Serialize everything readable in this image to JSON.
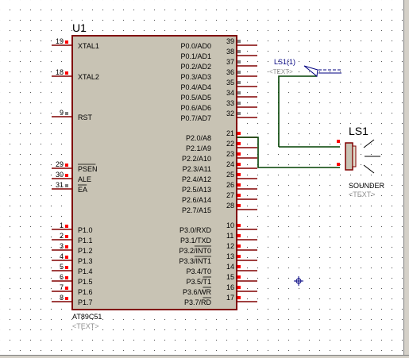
{
  "mcu": {
    "ref": "U1",
    "part": "AT89C51",
    "text_placeholder": "<TEXT>",
    "left_pins": [
      {
        "num": "19",
        "name": "XTAL1",
        "over": false
      },
      {
        "num": "18",
        "name": "XTAL2",
        "over": false
      },
      {
        "num": "9",
        "name": "RST",
        "over": false
      },
      {
        "num": "29",
        "name": "PSEN",
        "over": true
      },
      {
        "num": "30",
        "name": "ALE",
        "over": false
      },
      {
        "num": "31",
        "name": "EA",
        "over": true
      },
      {
        "num": "1",
        "name": "P1.0",
        "over": false
      },
      {
        "num": "2",
        "name": "P1.1",
        "over": false
      },
      {
        "num": "3",
        "name": "P1.2",
        "over": false
      },
      {
        "num": "4",
        "name": "P1.3",
        "over": false
      },
      {
        "num": "5",
        "name": "P1.4",
        "over": false
      },
      {
        "num": "6",
        "name": "P1.5",
        "over": false
      },
      {
        "num": "7",
        "name": "P1.6",
        "over": false
      },
      {
        "num": "8",
        "name": "P1.7",
        "over": false
      }
    ],
    "right_pins": [
      {
        "num": "39",
        "name": "P0.0/AD0",
        "over": ""
      },
      {
        "num": "38",
        "name": "P0.1/AD1",
        "over": ""
      },
      {
        "num": "37",
        "name": "P0.2/AD2",
        "over": ""
      },
      {
        "num": "36",
        "name": "P0.3/AD3",
        "over": ""
      },
      {
        "num": "35",
        "name": "P0.4/AD4",
        "over": ""
      },
      {
        "num": "34",
        "name": "P0.5/AD5",
        "over": ""
      },
      {
        "num": "33",
        "name": "P0.6/AD6",
        "over": ""
      },
      {
        "num": "32",
        "name": "P0.7/AD7",
        "over": ""
      },
      {
        "num": "21",
        "name": "P2.0/A8",
        "over": ""
      },
      {
        "num": "22",
        "name": "P2.1/A9",
        "over": ""
      },
      {
        "num": "23",
        "name": "P2.2/A10",
        "over": ""
      },
      {
        "num": "24",
        "name": "P2.3/A11",
        "over": ""
      },
      {
        "num": "25",
        "name": "P2.4/A12",
        "over": ""
      },
      {
        "num": "26",
        "name": "P2.5/A13",
        "over": ""
      },
      {
        "num": "27",
        "name": "P2.6/A14",
        "over": ""
      },
      {
        "num": "28",
        "name": "P2.7/A15",
        "over": ""
      },
      {
        "num": "10",
        "name": "P3.0/RXD",
        "over": ""
      },
      {
        "num": "11",
        "name": "P3.1/TXD",
        "over": ""
      },
      {
        "num": "12",
        "name": "P3.2/INT0",
        "over": "INT0"
      },
      {
        "num": "13",
        "name": "P3.3/INT1",
        "over": "INT1"
      },
      {
        "num": "14",
        "name": "P3.4/T0",
        "over": ""
      },
      {
        "num": "15",
        "name": "P3.5/T1",
        "over": "T1"
      },
      {
        "num": "16",
        "name": "P3.6/WR",
        "over": "WR"
      },
      {
        "num": "17",
        "name": "P3.7/RD",
        "over": "RD"
      }
    ]
  },
  "probe": {
    "label": "LS1(1)",
    "text_placeholder": "<TEXT>"
  },
  "sounder": {
    "ref": "LS1",
    "part": "SOUNDER",
    "text_placeholder": "<TEXT>"
  },
  "colors": {
    "canvas": "#ffffff",
    "body_fill": "#c8c3b4",
    "outline": "#800000",
    "wire": "#004000",
    "probe": "#000080",
    "pin_dot": "#ff0000",
    "pin_dot_dark": "#808080",
    "text": "#000000",
    "placeholder": "#909090"
  }
}
